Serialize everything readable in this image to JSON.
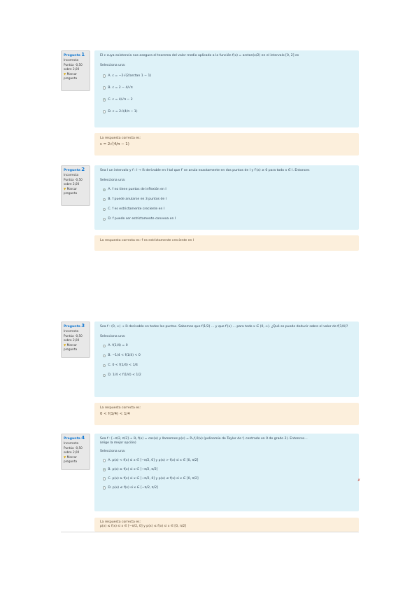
{
  "questions": [
    {
      "title": "Pregunta",
      "number": "1",
      "status": "Incorrecta",
      "score": "Puntúa -0,50 sobre 2,00",
      "flag": "Marcar pregunta",
      "prompt": "El c cuya existencia nos asegura el teorema del valor medio aplicado a la función f(x) = arctan(x/2) en el intervalo [0, 2] es",
      "select_label": "Selecciona una:",
      "options": [
        "A. c = −2√(2/arctan 1 − 1)",
        "B. c = 2 − 4/√π",
        "C. c = 4/√π − 2",
        "D. c = 2√(4/π − 1)"
      ],
      "selected_index": 2,
      "correct_answer_label": "La respuesta correcta es:",
      "correct_answer": "c = 2√(4/π − 1)"
    },
    {
      "title": "Pregunta",
      "number": "2",
      "status": "Incorrecta",
      "score": "Puntúa -0,50 sobre 2,00",
      "flag": "Marcar pregunta",
      "prompt": "Sea I un intervalo y f : I → ℝ derivable en I tal que f′ se anula exactamente en dos puntos de I y f′(x) ≥ 0 para todo x ∈ I. Entonces",
      "select_label": "Selecciona una:",
      "options": [
        "A. f no tiene puntos de inflexión en I",
        "B. f puede anularse en 3 puntos de I",
        "C. f es estrictamente creciente en I",
        "D. f puede ser estrictamente convexa en I"
      ],
      "selected_index": 0,
      "correct_answer_label": "La respuesta correcta es: f es estrictamente creciente en I",
      "correct_answer": ""
    },
    {
      "title": "Pregunta",
      "number": "3",
      "status": "Incorrecta",
      "score": "Puntúa -0,50 sobre 2,00",
      "flag": "Marcar pregunta",
      "prompt": "Sea f : (0, ∞) → ℝ derivable en todos los puntos. Sabemos que f(1/2) ... y que f′(x) ... para todo x ∈ (0, ∞). ¿Qué se puede deducir sobre el valor de f(1/4)?",
      "select_label": "Selecciona una:",
      "options": [
        "A. f(1/4) = 0",
        "B. −1/4 < f(1/4) < 0",
        "C. 0 < f(1/4) < 1/4",
        "D. 1/4 < f(1/4) < 1/2"
      ],
      "selected_index": -1,
      "correct_answer_label": "La respuesta correcta es:",
      "correct_answer": "0 < f(1/4) < 1/4"
    },
    {
      "title": "Pregunta",
      "number": "4",
      "status": "Incorrecta",
      "score": "Puntúa -0,50 sobre 2,00",
      "flag": "Marcar pregunta",
      "prompt": "Sea f : [−π/2, π/2] → ℝ, f(x) = cos(x) y llamemos p(x) = P₂,f,0(x) (polinomio de Taylor de f, centrado en 0 de grado 2). Entonces...",
      "prompt_extra": "(elige la mejor opción)",
      "select_label": "Selecciona una:",
      "options": [
        "A. p(x) < f(x) si x ∈ [−π/2, 0] y p(x) > f(x) si x ∈ [0, π/2]",
        "B. p(x) ≥ f(x) si x ∈ [−π/2, π/2]",
        "C. p(x) ≥ f(x) si x ∈ [−π/2, 0] y p(x) ≤ f(x) si x ∈ [0, π/2]",
        "D. p(x) ≤ f(x) si x ∈ [−π/2, π/2]"
      ],
      "selected_index": 1,
      "correct_answer_label": "La respuesta correcta es:",
      "correct_answer": "p(x) ≤ f(x) si x ∈ [−π/2, 0] y p(x) ≤ f(x) si x ∈ [0, π/2]"
    }
  ],
  "incorrect_mark": "✗"
}
